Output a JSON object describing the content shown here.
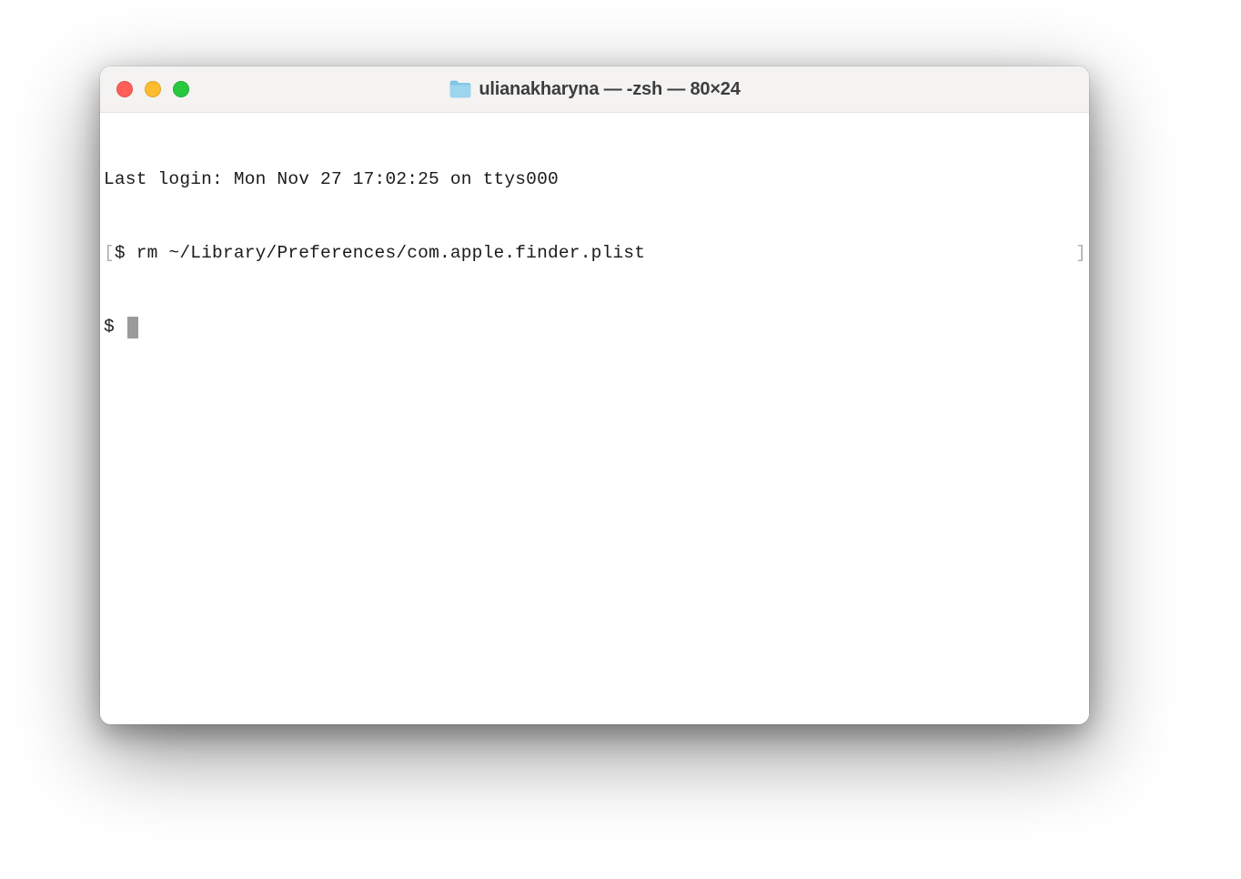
{
  "window": {
    "title": "ulianakharyna — -zsh — 80×24"
  },
  "terminal": {
    "last_login": "Last login: Mon Nov 27 17:02:25 on ttys000",
    "bracket_left": "[",
    "bracket_right": "]",
    "prompt1_symbol": "$ ",
    "prompt1_command": "rm ~/Library/Preferences/com.apple.finder.plist",
    "prompt2_symbol": "$ "
  }
}
